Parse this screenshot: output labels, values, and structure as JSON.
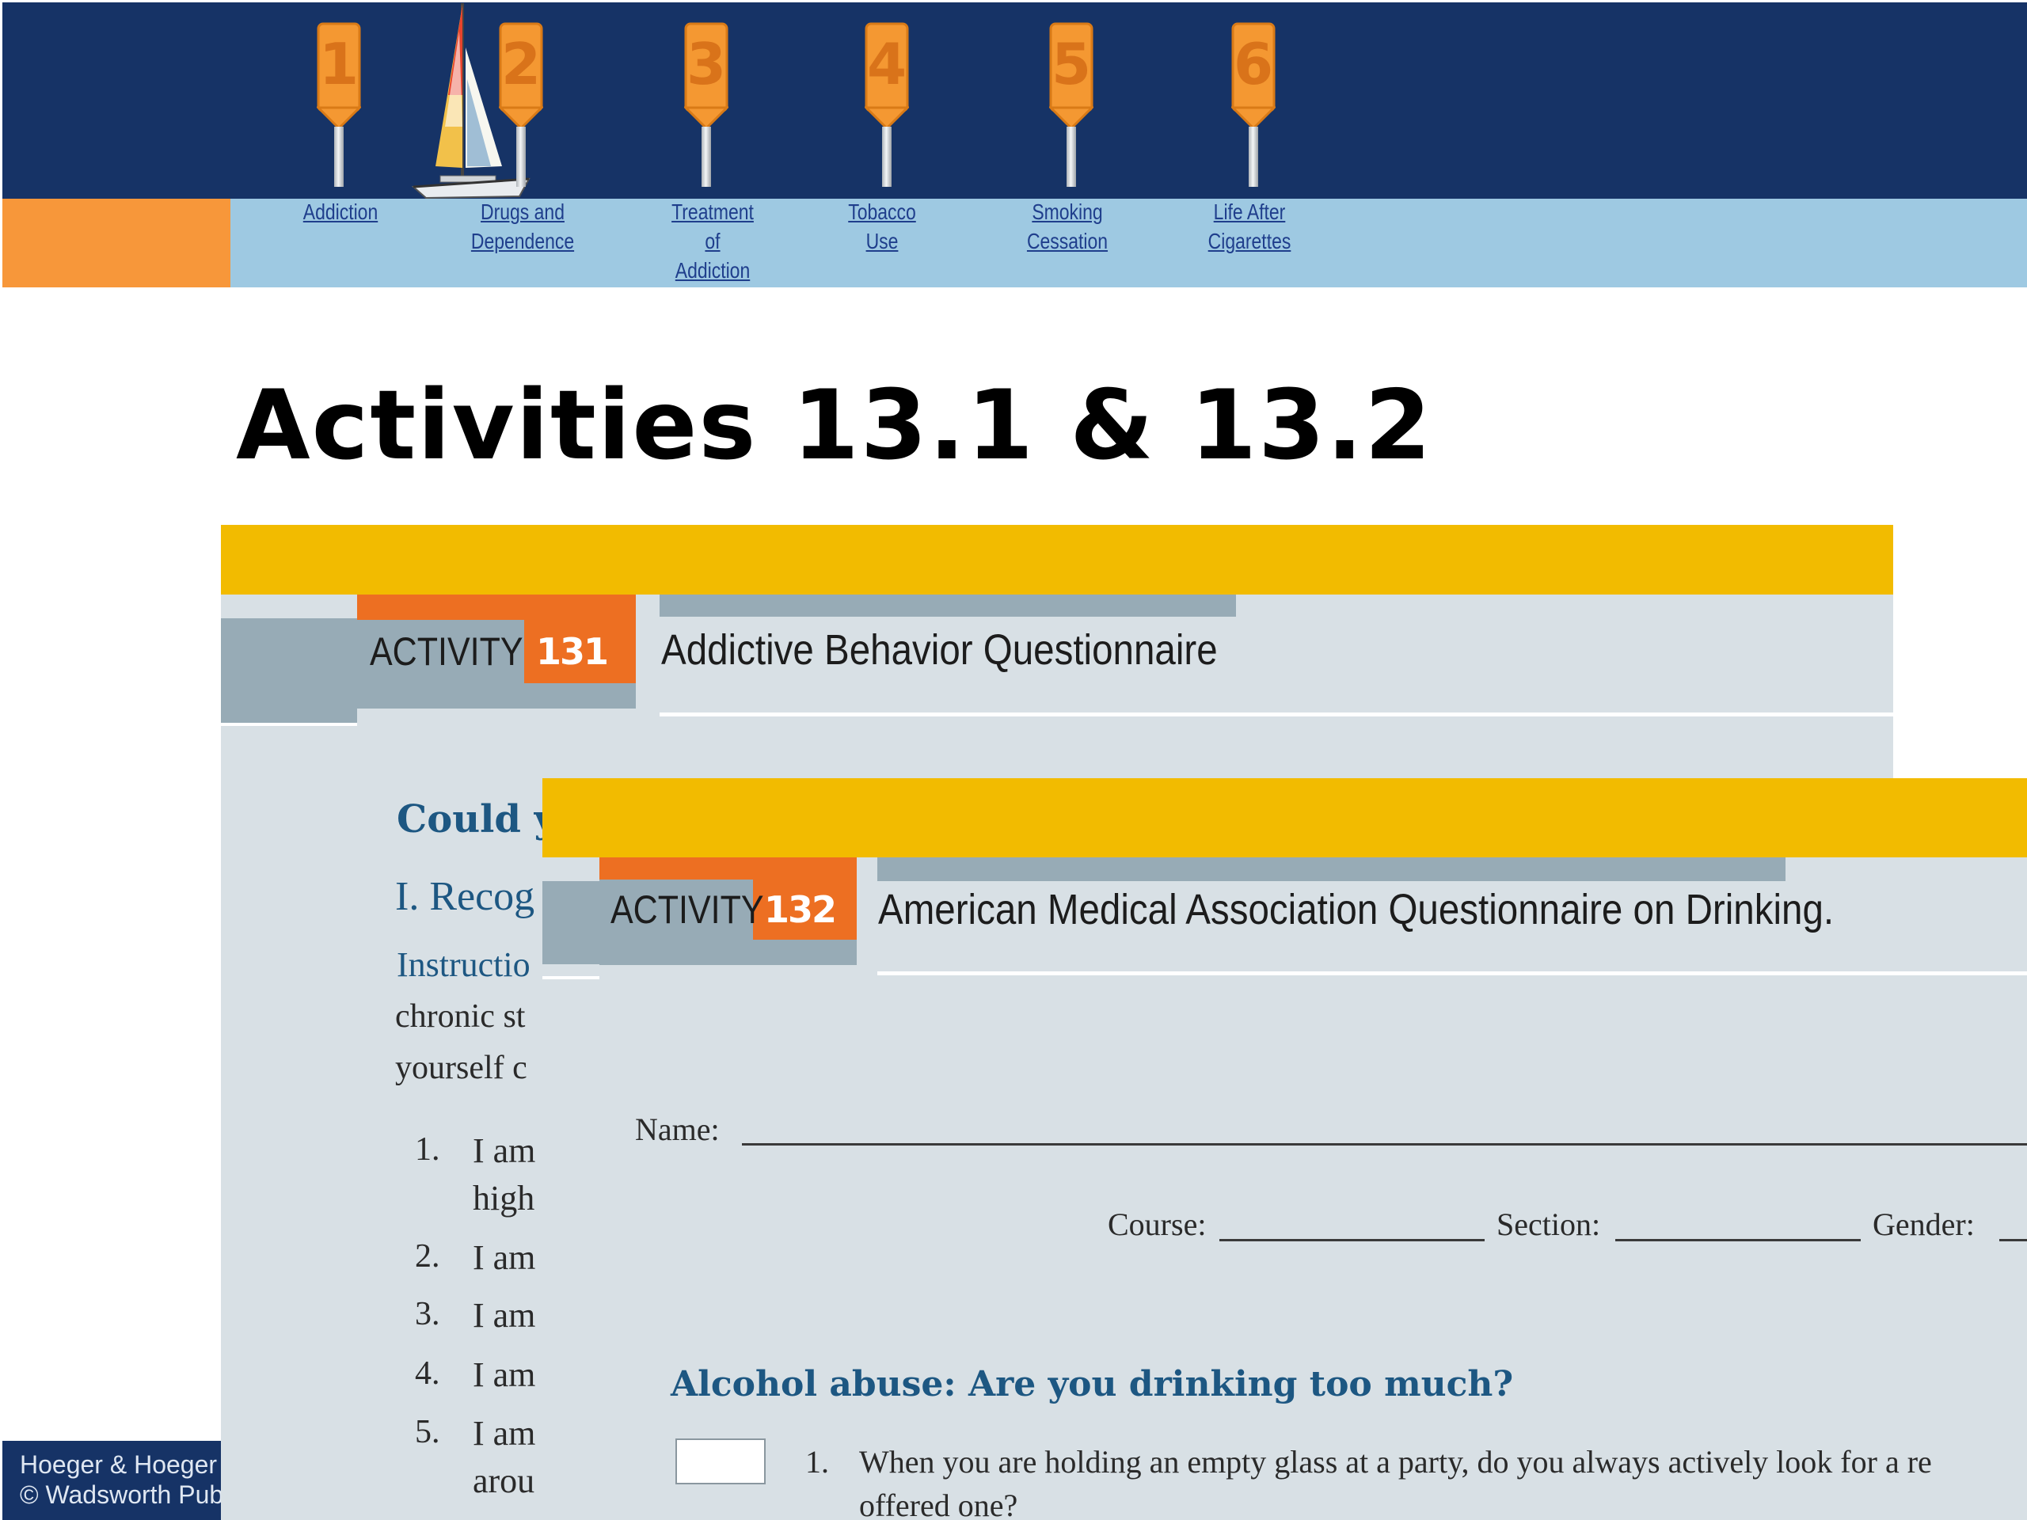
{
  "nav": {
    "items": [
      {
        "number": "1",
        "label": "Addiction"
      },
      {
        "number": "2",
        "label": "Drugs and\nDependence"
      },
      {
        "number": "3",
        "label": "Treatment\nof\nAddiction"
      },
      {
        "number": "4",
        "label": "Tobacco\nUse"
      },
      {
        "number": "5",
        "label": "Smoking\nCessation"
      },
      {
        "number": "6",
        "label": "Life After\nCigarettes"
      }
    ]
  },
  "colors": {
    "navy": "#163366",
    "orange": "#f7973a",
    "light_blue": "#9ec9e2",
    "marker_orange": "#f49832",
    "panel_yellow": "#f2bb00",
    "activity_orange": "#ed6f22",
    "link_blue": "#1f3e8c"
  },
  "page": {
    "title": "Activities 13.1 & 13.2"
  },
  "activity1": {
    "word": "ACTIVITY",
    "number": "131",
    "title": "Addictive Behavior Questionnaire",
    "heading": "Could y",
    "section": "I.  Recog",
    "instructions": "Instructio",
    "body_line1": "chronic st",
    "body_line2": "yourself c",
    "items": [
      {
        "num": "1.",
        "text": "I am",
        "cont": "high"
      },
      {
        "num": "2.",
        "text": "I am",
        "cont": ""
      },
      {
        "num": "3.",
        "text": "I am",
        "cont": ""
      },
      {
        "num": "4.",
        "text": "I am",
        "cont": ""
      },
      {
        "num": "5.",
        "text": "I am",
        "cont": "arou"
      }
    ]
  },
  "activity2": {
    "word": "ACTIVITY",
    "number": "132",
    "title": "American Medical Association Questionnaire on Drinking.",
    "name_label": "Name:",
    "course_label": "Course:",
    "section_label": "Section:",
    "gender_label": "Gender:",
    "heading": "Alcohol abuse:  Are you drinking too much?",
    "q1_num": "1.",
    "q1_line1": "When you are holding an empty glass at a party, do you always actively look for a re",
    "q1_line2": "offered one?"
  },
  "footer": {
    "line1": "Hoeger & Hoeger",
    "line2": "© Wadsworth Pub"
  }
}
